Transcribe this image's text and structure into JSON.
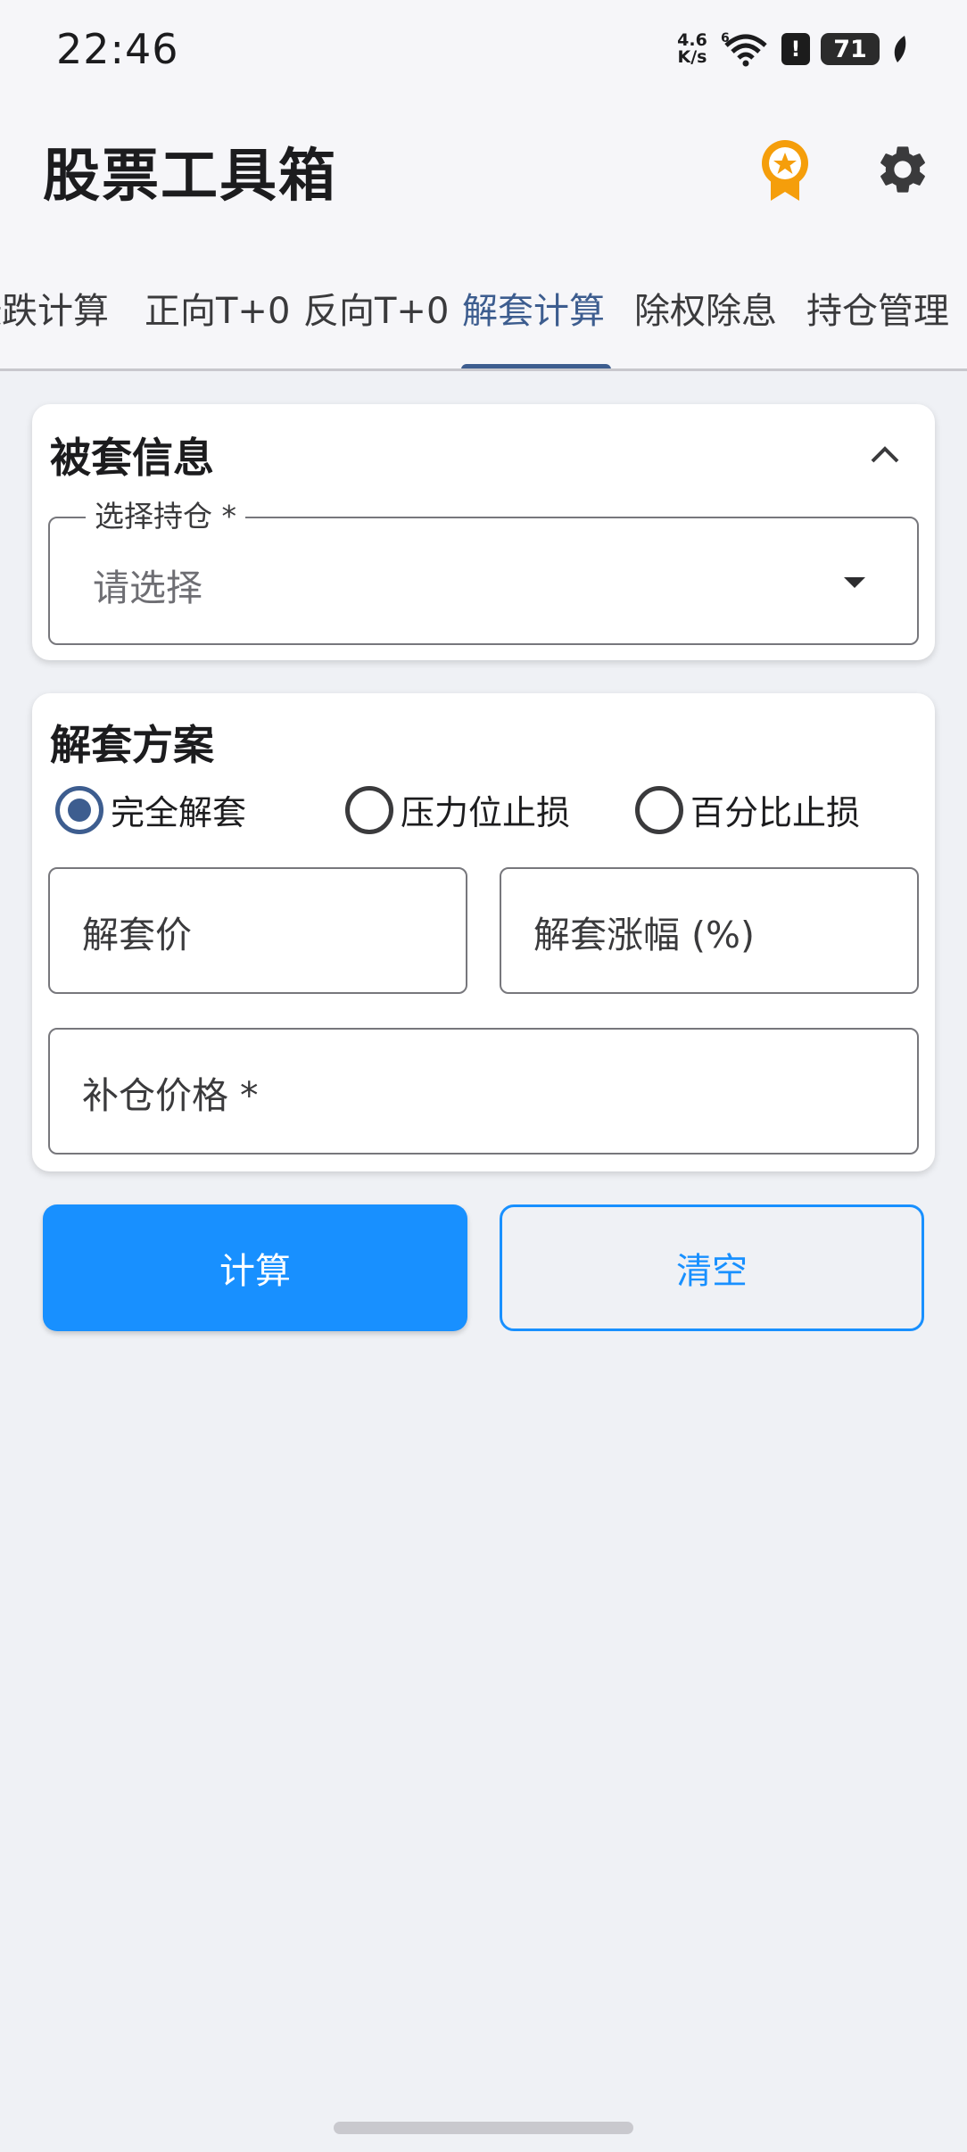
{
  "status": {
    "time": "22:46",
    "net_speed_value": "4.6",
    "net_speed_unit": "K/s",
    "signal_label": "6",
    "battery": "71"
  },
  "app": {
    "title": "股票工具箱"
  },
  "tabs": [
    {
      "label": "涨跌计算",
      "active": false
    },
    {
      "label": "正向T+0",
      "active": false
    },
    {
      "label": "反向T+0",
      "active": false
    },
    {
      "label": "解套计算",
      "active": true
    },
    {
      "label": "除权除息",
      "active": false
    },
    {
      "label": "持仓管理",
      "active": false
    }
  ],
  "trapped_info": {
    "title": "被套信息",
    "select": {
      "label": "选择持仓 *",
      "placeholder": "请选择"
    }
  },
  "plan": {
    "title": "解套方案",
    "options": [
      {
        "label": "完全解套",
        "checked": true
      },
      {
        "label": "压力位止损",
        "checked": false
      },
      {
        "label": "百分比止损",
        "checked": false
      }
    ],
    "fields": {
      "unlock_price": "解套价",
      "unlock_rise": "解套涨幅 (%)",
      "add_price": "补仓价格 *"
    }
  },
  "buttons": {
    "calculate": "计算",
    "clear": "清空"
  },
  "colors": {
    "accent": "#3d5d8f",
    "primary_button": "#1890ff",
    "background": "#eff1f5"
  }
}
